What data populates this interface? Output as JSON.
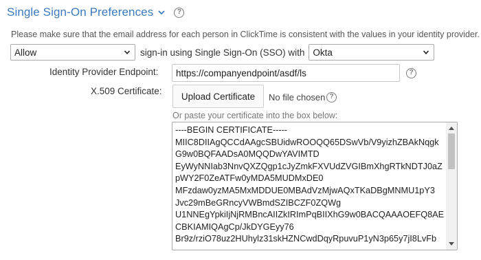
{
  "header": {
    "title": "Single Sign-On Preferences",
    "help_glyph": "?"
  },
  "notice": "Please make sure that the email address for each person in ClickTime is consistent with the values in your identity provider.",
  "sso": {
    "mode_selected": "Allow",
    "connector_text": "sign-in using Single Sign-On (SSO) with",
    "provider_selected": "Okta"
  },
  "endpoint": {
    "label": "Identity Provider Endpoint:",
    "value": "https://companyendpoint/asdf/ls",
    "help_glyph": "?"
  },
  "certificate": {
    "label": "X.509 Certificate:",
    "upload_label": "Upload Certificate",
    "no_file_text": "No file chosen",
    "help_glyph": "?",
    "paste_label": "Or paste your certificate into the box below:",
    "lines": [
      "----BEGIN CERTIFICATE-----",
      "MIIC8DIIAgQCCdAAgcSBUidwROOQQ65DSwVb/V9yizhZBAkNqgk",
      "G9w0BQFAADsA0MQQDwYAVIMTD",
      "EyWyNNIab3NnvQXZQgp1cJyZmkFXVUdZVGIBmXhgRTkNDTJ0aZ",
      "pWY2F0ZeATFw0yMDA5MUDMxDE0",
      "MFzdaw0yzMA5MxMDDUE0MBAdVzMjwAQxTKaDBgMNMU1pY3",
      "Jvc29mBeGRncyVWBmdSZIBCZF0ZQWg",
      "U1NNEgYpkiIjNjRMBncAIIZkIRImPqBIIXhG9w0BACQAAAOEFQ8AE",
      "CBKIAMIQAgCp/JkDYGEyy76",
      "Br9z/rziO78uz2HUhylz31skHZNCwdDqyRpuvuP1yN3p65y7jI8LvFb"
    ]
  },
  "icons": {
    "title_chevron": "chevron-down-icon",
    "help": "help-circle-icon",
    "select_caret": "chevron-down-icon"
  },
  "colors": {
    "title": "#3a7bbf",
    "text": "#333333"
  }
}
